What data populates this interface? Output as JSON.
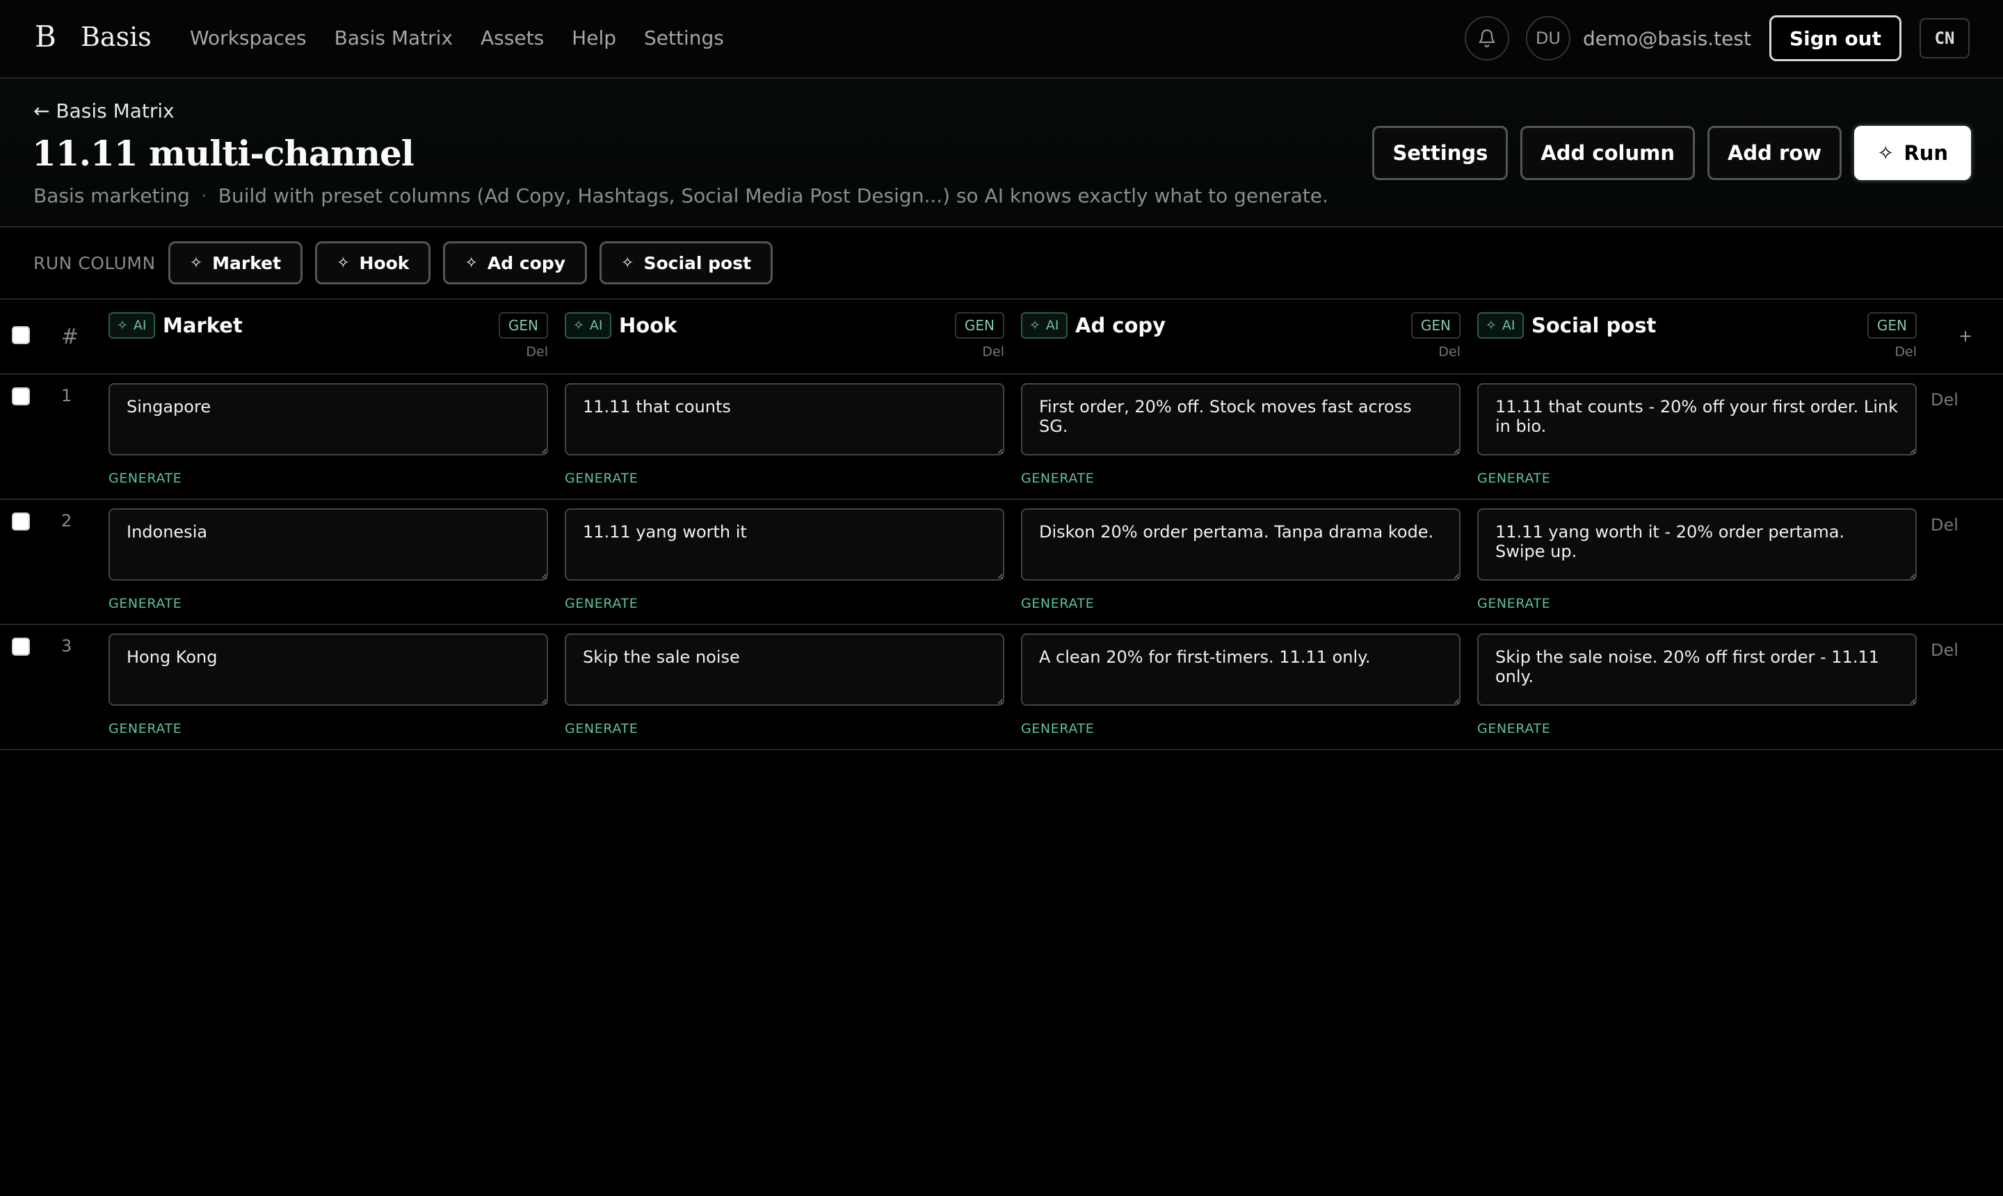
{
  "app": {
    "brand_mark": "B",
    "brand_name": "Basis",
    "nav": [
      "Workspaces",
      "Basis Matrix",
      "Assets",
      "Help",
      "Settings"
    ],
    "user": {
      "initials": "DU",
      "email": "demo@basis.test"
    },
    "sign_out_label": "Sign out",
    "lang_label": "CN",
    "icons": {
      "notifications": "bell-icon"
    }
  },
  "page": {
    "back_label": "← Basis Matrix",
    "title": "11.11 multi-channel",
    "workspace": "Basis marketing",
    "separator": "·",
    "description": "Build with preset columns (Ad Copy, Hashtags, Social Media Post Design...) so AI knows exactly what to generate.",
    "actions": {
      "settings": "Settings",
      "add_column": "Add column",
      "add_row": "Add row",
      "run": "Run"
    }
  },
  "run_column": {
    "label": "RUN COLUMN",
    "chips": [
      "Market",
      "Hook",
      "Ad copy",
      "Social post"
    ]
  },
  "table": {
    "hash_label": "#",
    "add_column_label": "+",
    "columns": [
      {
        "name": "Market",
        "ai_label": "AI",
        "gen_label": "GEN",
        "del_label": "Del"
      },
      {
        "name": "Hook",
        "ai_label": "AI",
        "gen_label": "GEN",
        "del_label": "Del"
      },
      {
        "name": "Ad copy",
        "ai_label": "AI",
        "gen_label": "GEN",
        "del_label": "Del"
      },
      {
        "name": "Social post",
        "ai_label": "AI",
        "gen_label": "GEN",
        "del_label": "Del"
      }
    ],
    "generate_label": "GENERATE",
    "row_del_label": "Del",
    "rows": [
      {
        "num": "1",
        "cells": [
          "Singapore",
          "11.11 that counts",
          "First order, 20% off. Stock moves fast across SG.",
          "11.11 that counts - 20% off your first order. Link in bio."
        ]
      },
      {
        "num": "2",
        "cells": [
          "Indonesia",
          "11.11 yang worth it",
          "Diskon 20% order pertama. Tanpa drama kode.",
          "11.11 yang worth it - 20% order pertama. Swipe up."
        ]
      },
      {
        "num": "3",
        "cells": [
          "Hong Kong",
          "Skip the sale noise",
          "A clean 20% for first-timers. 11.11 only.",
          "Skip the sale noise. 20% off first order - 11.11 only."
        ]
      }
    ]
  },
  "colors": {
    "accent_green": "#5cc39c",
    "background": "#000000",
    "border": "#262626"
  }
}
